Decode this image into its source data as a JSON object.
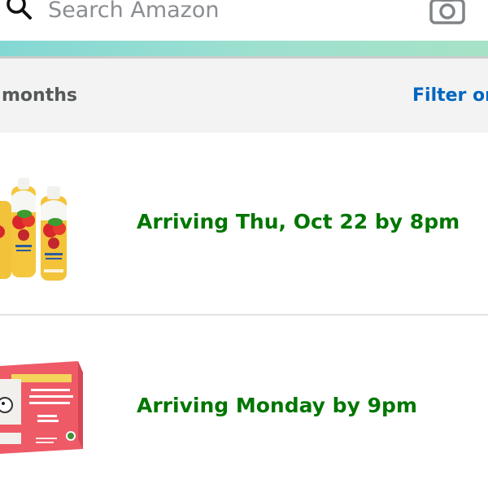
{
  "search": {
    "placeholder": "Search Amazon",
    "search_icon": "search-icon",
    "camera_icon": "camera-icon"
  },
  "filter_bar": {
    "label": "months",
    "link": "Filter or"
  },
  "colors": {
    "accent_gradient_start": "#84d8d4",
    "accent_gradient_end": "#a6e3c6",
    "filter_background": "#f3f3f3",
    "link_blue": "#0066c0",
    "status_green": "#007600",
    "placeholder_gray": "#8a8d91"
  },
  "orders": [
    {
      "status": "Arriving Thu, Oct 22 by 8pm",
      "thumbnail_icon": "produce-wash-bottles-image"
    },
    {
      "status": "Arriving Monday by 9pm",
      "thumbnail_icon": "milk-carton-pack-image"
    }
  ]
}
